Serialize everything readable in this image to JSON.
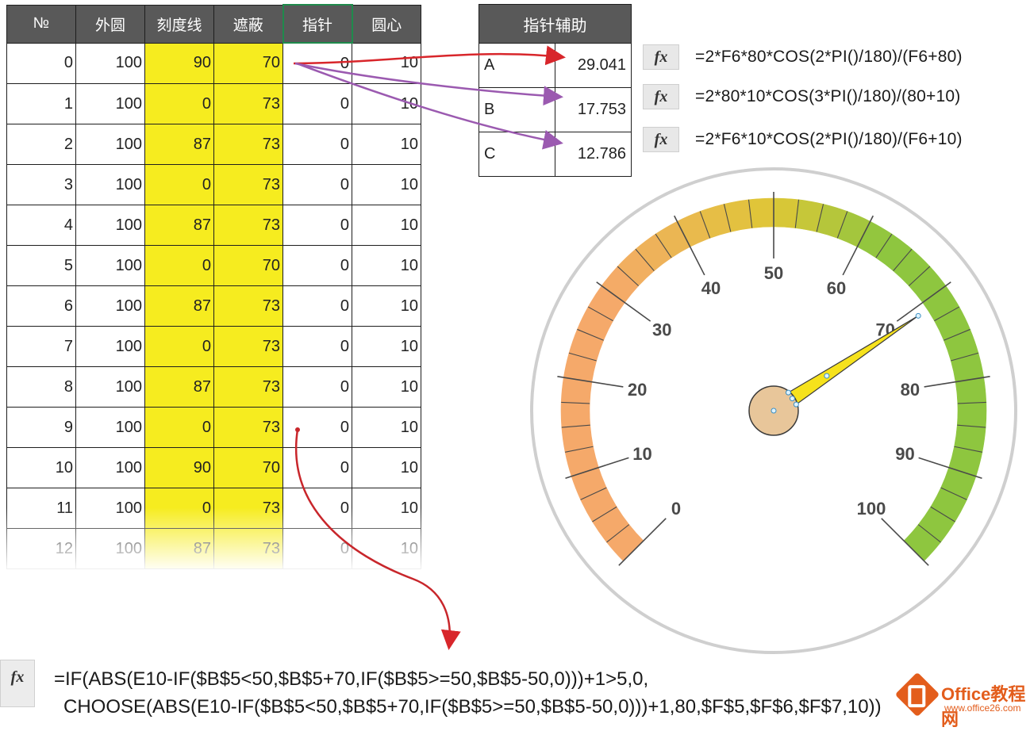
{
  "sheet": {
    "headers": [
      "№",
      "外圆",
      "刻度线",
      "遮蔽",
      "指针",
      "圆心"
    ],
    "rows": [
      [
        "0",
        "100",
        "90",
        "70",
        "0",
        "10"
      ],
      [
        "1",
        "100",
        "0",
        "73",
        "0",
        "10"
      ],
      [
        "2",
        "100",
        "87",
        "73",
        "0",
        "10"
      ],
      [
        "3",
        "100",
        "0",
        "73",
        "0",
        "10"
      ],
      [
        "4",
        "100",
        "87",
        "73",
        "0",
        "10"
      ],
      [
        "5",
        "100",
        "0",
        "70",
        "0",
        "10"
      ],
      [
        "6",
        "100",
        "87",
        "73",
        "0",
        "10"
      ],
      [
        "7",
        "100",
        "0",
        "73",
        "0",
        "10"
      ],
      [
        "8",
        "100",
        "87",
        "73",
        "0",
        "10"
      ],
      [
        "9",
        "100",
        "0",
        "73",
        "0",
        "10"
      ],
      [
        "10",
        "100",
        "90",
        "70",
        "0",
        "10"
      ],
      [
        "11",
        "100",
        "0",
        "73",
        "0",
        "10"
      ],
      [
        "12",
        "100",
        "87",
        "73",
        "0",
        "10"
      ]
    ],
    "highlight_color": "#f6ec1f",
    "header_color": "#595959"
  },
  "helper": {
    "title": "指针辅助",
    "rows": [
      {
        "label": "A",
        "value": "29.041"
      },
      {
        "label": "B",
        "value": "17.753"
      },
      {
        "label": "C",
        "value": "12.786"
      }
    ]
  },
  "formulas": {
    "fx_icon": "fx-icon",
    "items": [
      "=2*F6*80*COS(2*PI()/180)/(F6+80)",
      "=2*80*10*COS(3*PI()/180)/(80+10)",
      "=2*F6*10*COS(2*PI()/180)/(F6+10)"
    ]
  },
  "gauge": {
    "labels": [
      "0",
      "10",
      "20",
      "30",
      "40",
      "50",
      "60",
      "70",
      "80",
      "90",
      "100"
    ],
    "pointer_value": 71,
    "colors": {
      "low": "#f5a96a",
      "mid": "#dfc736",
      "high": "#8ec63f",
      "pointer": "#f6e21c",
      "hub": "#e8c69a"
    }
  },
  "bottom_formula": {
    "line1": "=IF(ABS(E10-IF($B$5<50,$B$5+70,IF($B$5>=50,$B$5-50,0)))+1>5,0,",
    "line2": "CHOOSE(ABS(E10-IF($B$5<50,$B$5+70,IF($B$5>=50,$B$5-50,0)))+1,80,$F$5,$F$6,$F$7,10))"
  },
  "watermark": {
    "title": "Office教程网",
    "url": "www.office26.com"
  }
}
